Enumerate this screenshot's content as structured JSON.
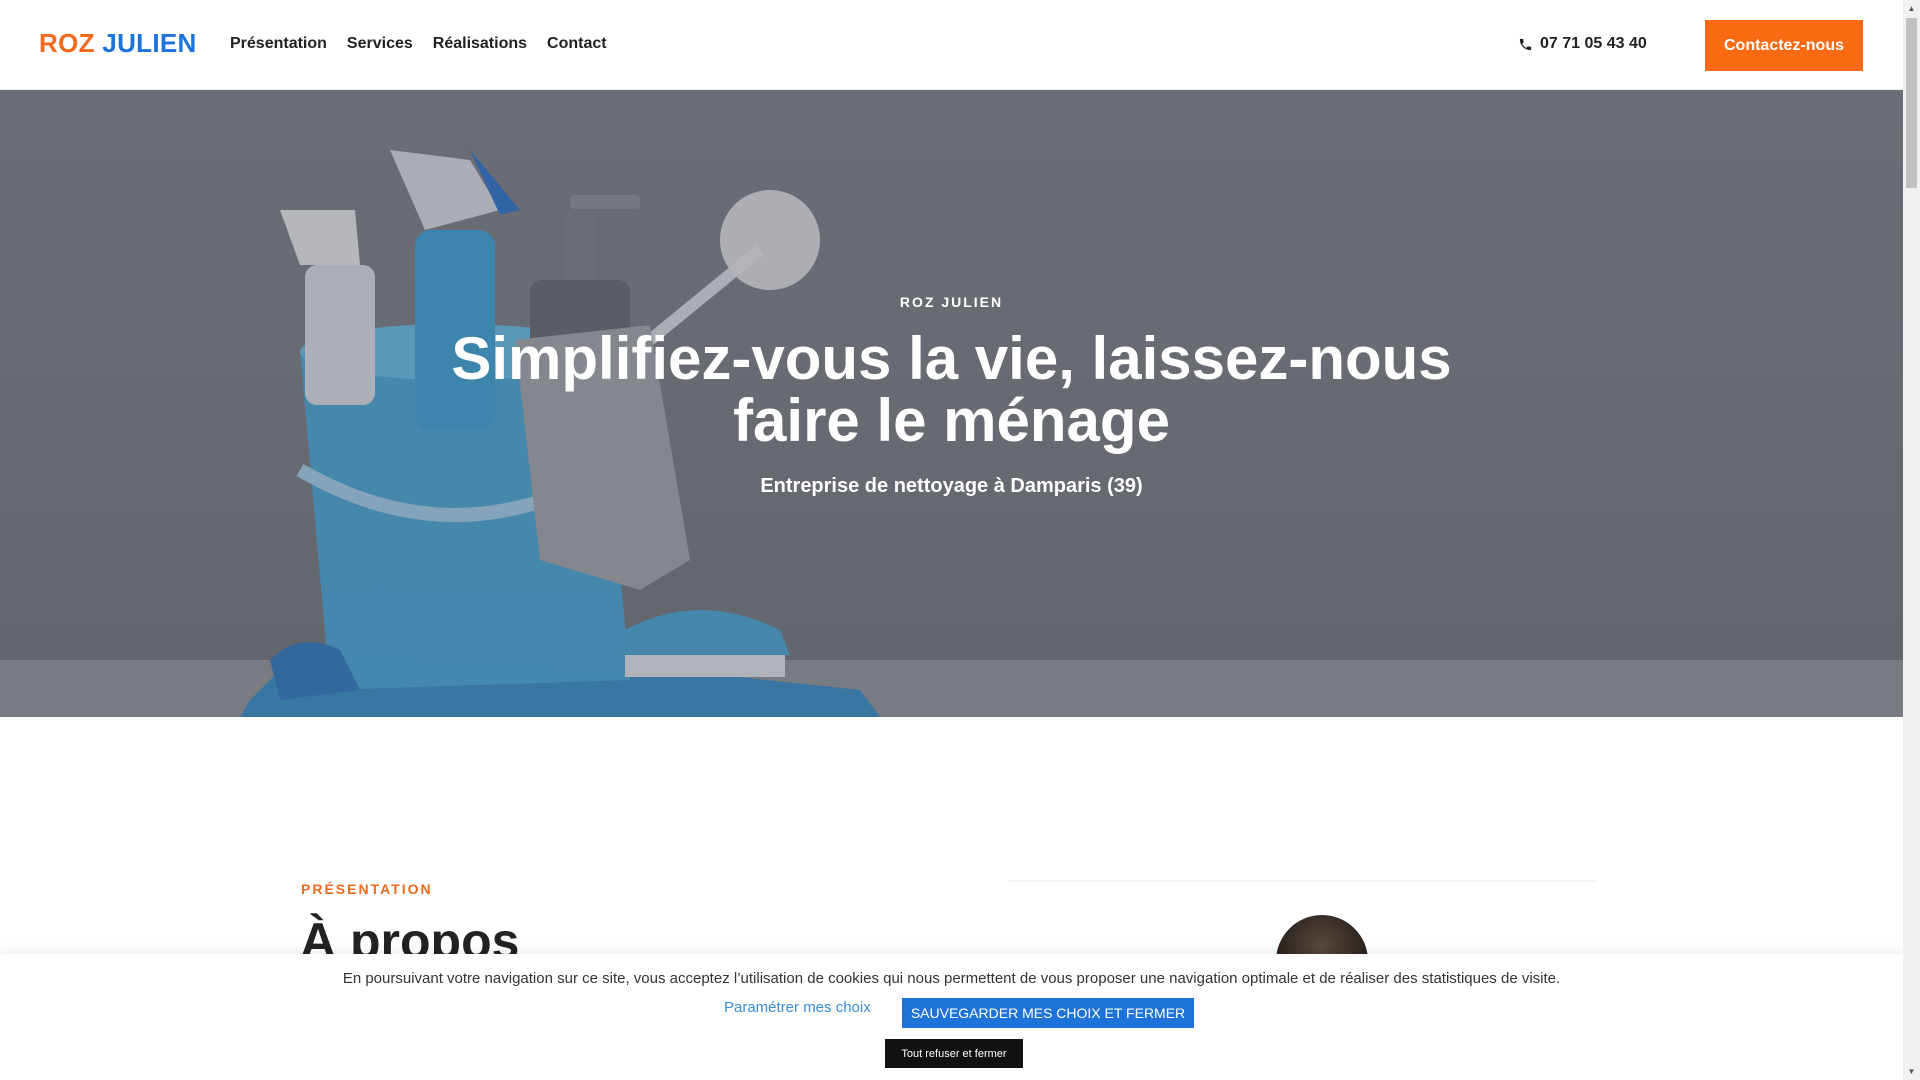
{
  "header": {
    "logo_part1": "ROZ",
    "logo_part2": "JULIEN",
    "nav": [
      "Présentation",
      "Services",
      "Réalisations",
      "Contact"
    ],
    "phone": "07 71 05 43 40",
    "cta": "Contactez-nous"
  },
  "hero": {
    "eyebrow": "ROZ JULIEN",
    "title": "Simplifiez-vous la vie, laissez-nous faire le ménage",
    "subtitle": "Entreprise de nettoyage à Damparis (39)"
  },
  "about": {
    "eyebrow": "PRÉSENTATION",
    "title": "À propos"
  },
  "cookie": {
    "text": "En poursuivant votre navigation sur ce site, vous acceptez l’utilisation de cookies qui nous permettent de vous proposer une navigation optimale et de réaliser des statistiques de visite.",
    "settings_link": "Paramétrer mes choix",
    "save_button": "SAUVEGARDER MES CHOIX ET FERMER",
    "refuse_button": "Tout refuser et fermer"
  },
  "colors": {
    "orange": "#f96a12",
    "blue": "#1e73d8",
    "dark": "#222222"
  },
  "icons": {
    "phone": "phone-icon"
  }
}
